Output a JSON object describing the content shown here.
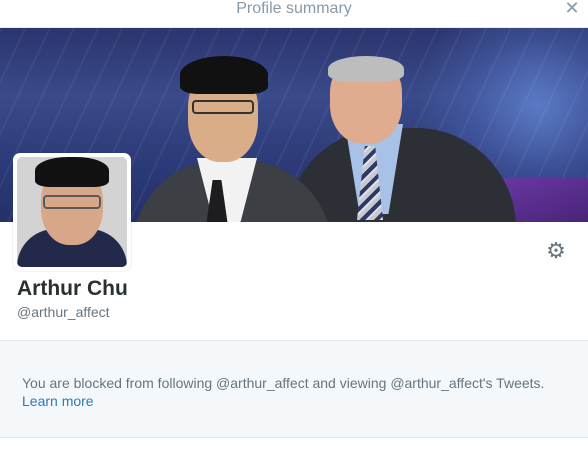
{
  "modal": {
    "title": "Profile summary",
    "close_icon": "close-icon"
  },
  "profile": {
    "name": "Arthur Chu",
    "handle": "@arthur_affect",
    "settings_icon": "gear-icon"
  },
  "blocked": {
    "message": "You are blocked from following @arthur_affect and viewing @arthur_affect's Tweets.",
    "learn_more_label": "Learn more"
  },
  "colors": {
    "link": "#2b7bb9",
    "name_text": "#292f33",
    "secondary_text": "#66757f",
    "notice_background": "#f5f8fa"
  }
}
